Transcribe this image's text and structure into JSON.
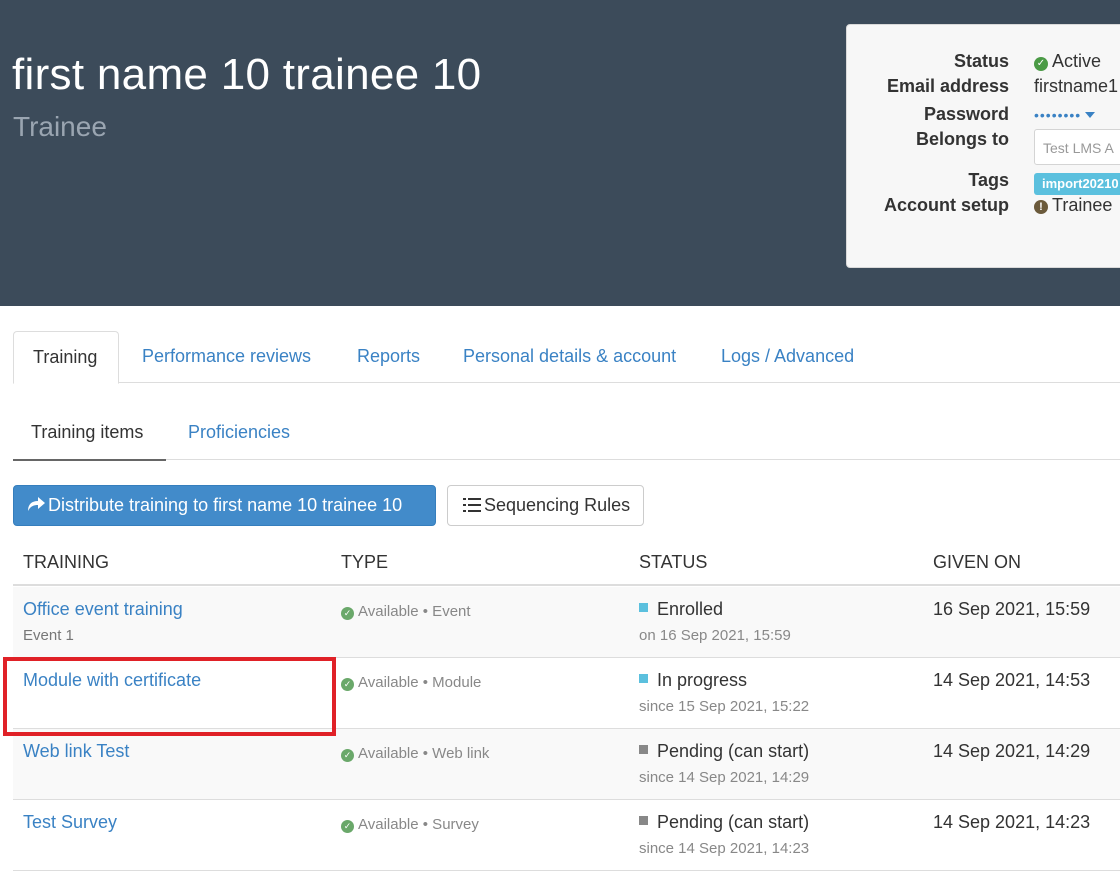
{
  "user": {
    "full_name": "first name 10 trainee 10",
    "role": "Trainee"
  },
  "info": {
    "status_label": "Status",
    "status_value": "Active",
    "email_label": "Email address",
    "email_value": "firstname1",
    "password_label": "Password",
    "password_value": "••••••••",
    "belongs_label": "Belongs to",
    "belongs_value": "Test LMS A",
    "tags_label": "Tags",
    "tag_value": "import20210",
    "setup_label": "Account setup",
    "setup_value": "Trainee"
  },
  "main_tabs": [
    {
      "label": "Training"
    },
    {
      "label": "Performance reviews"
    },
    {
      "label": "Reports"
    },
    {
      "label": "Personal details & account"
    },
    {
      "label": "Logs / Advanced"
    }
  ],
  "sub_tabs": [
    {
      "label": "Training items"
    },
    {
      "label": "Proficiencies"
    }
  ],
  "actions": {
    "distribute_label": "Distribute training to first name 10 trainee 10",
    "sequencing_label": "Sequencing Rules"
  },
  "table": {
    "headers": {
      "training": "TRAINING",
      "type": "TYPE",
      "status": "STATUS",
      "given_on": "GIVEN ON"
    },
    "rows": [
      {
        "title": "Office event training",
        "subtitle": "Event 1",
        "type": "Available • Event",
        "status": "Enrolled",
        "status_sub": "on 16 Sep 2021, 15:59",
        "given_on": "16 Sep 2021, 15:59"
      },
      {
        "title": "Module with certificate",
        "subtitle": "",
        "type": "Available • Module",
        "status": "In progress",
        "status_sub": "since 15 Sep 2021, 15:22",
        "given_on": "14 Sep 2021, 14:53"
      },
      {
        "title": "Web link Test",
        "subtitle": "",
        "type": "Available • Web link",
        "status": "Pending (can start)",
        "status_sub": "since 14 Sep 2021, 14:29",
        "given_on": "14 Sep 2021, 14:29"
      },
      {
        "title": "Test Survey",
        "subtitle": "",
        "type": "Available • Survey",
        "status": "Pending (can start)",
        "status_sub": "since 14 Sep 2021, 14:23",
        "given_on": "14 Sep 2021, 14:23"
      }
    ]
  },
  "colors": {
    "header_bg": "#3c4b5a",
    "link": "#3a82c4",
    "primary_button": "#428bca",
    "status_active": "#4a9a45",
    "status_enrolled": "#5bc0de",
    "status_pending": "#888888",
    "tag_badge": "#5bc0de",
    "highlight": "#e02127"
  }
}
